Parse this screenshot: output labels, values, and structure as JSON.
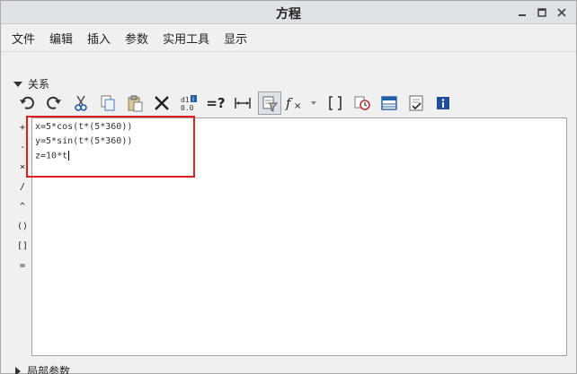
{
  "window": {
    "title": "方程"
  },
  "menu": [
    "文件",
    "编辑",
    "插入",
    "参数",
    "实用工具",
    "显示"
  ],
  "relations_section": {
    "label": "关系"
  },
  "toolbar": {
    "equals_q": "=?"
  },
  "operators": [
    "+",
    "-",
    "×",
    "/",
    "^",
    "()",
    "[]",
    "="
  ],
  "editor": {
    "lines": [
      "x=5*cos(t*(5*360))",
      "y=5*sin(t*(5*360))",
      "z=10*t"
    ]
  },
  "local_params_section": {
    "label": "局部参数"
  },
  "colors": {
    "highlight": "#e02020",
    "accent_blue": "#1f5fa8"
  }
}
